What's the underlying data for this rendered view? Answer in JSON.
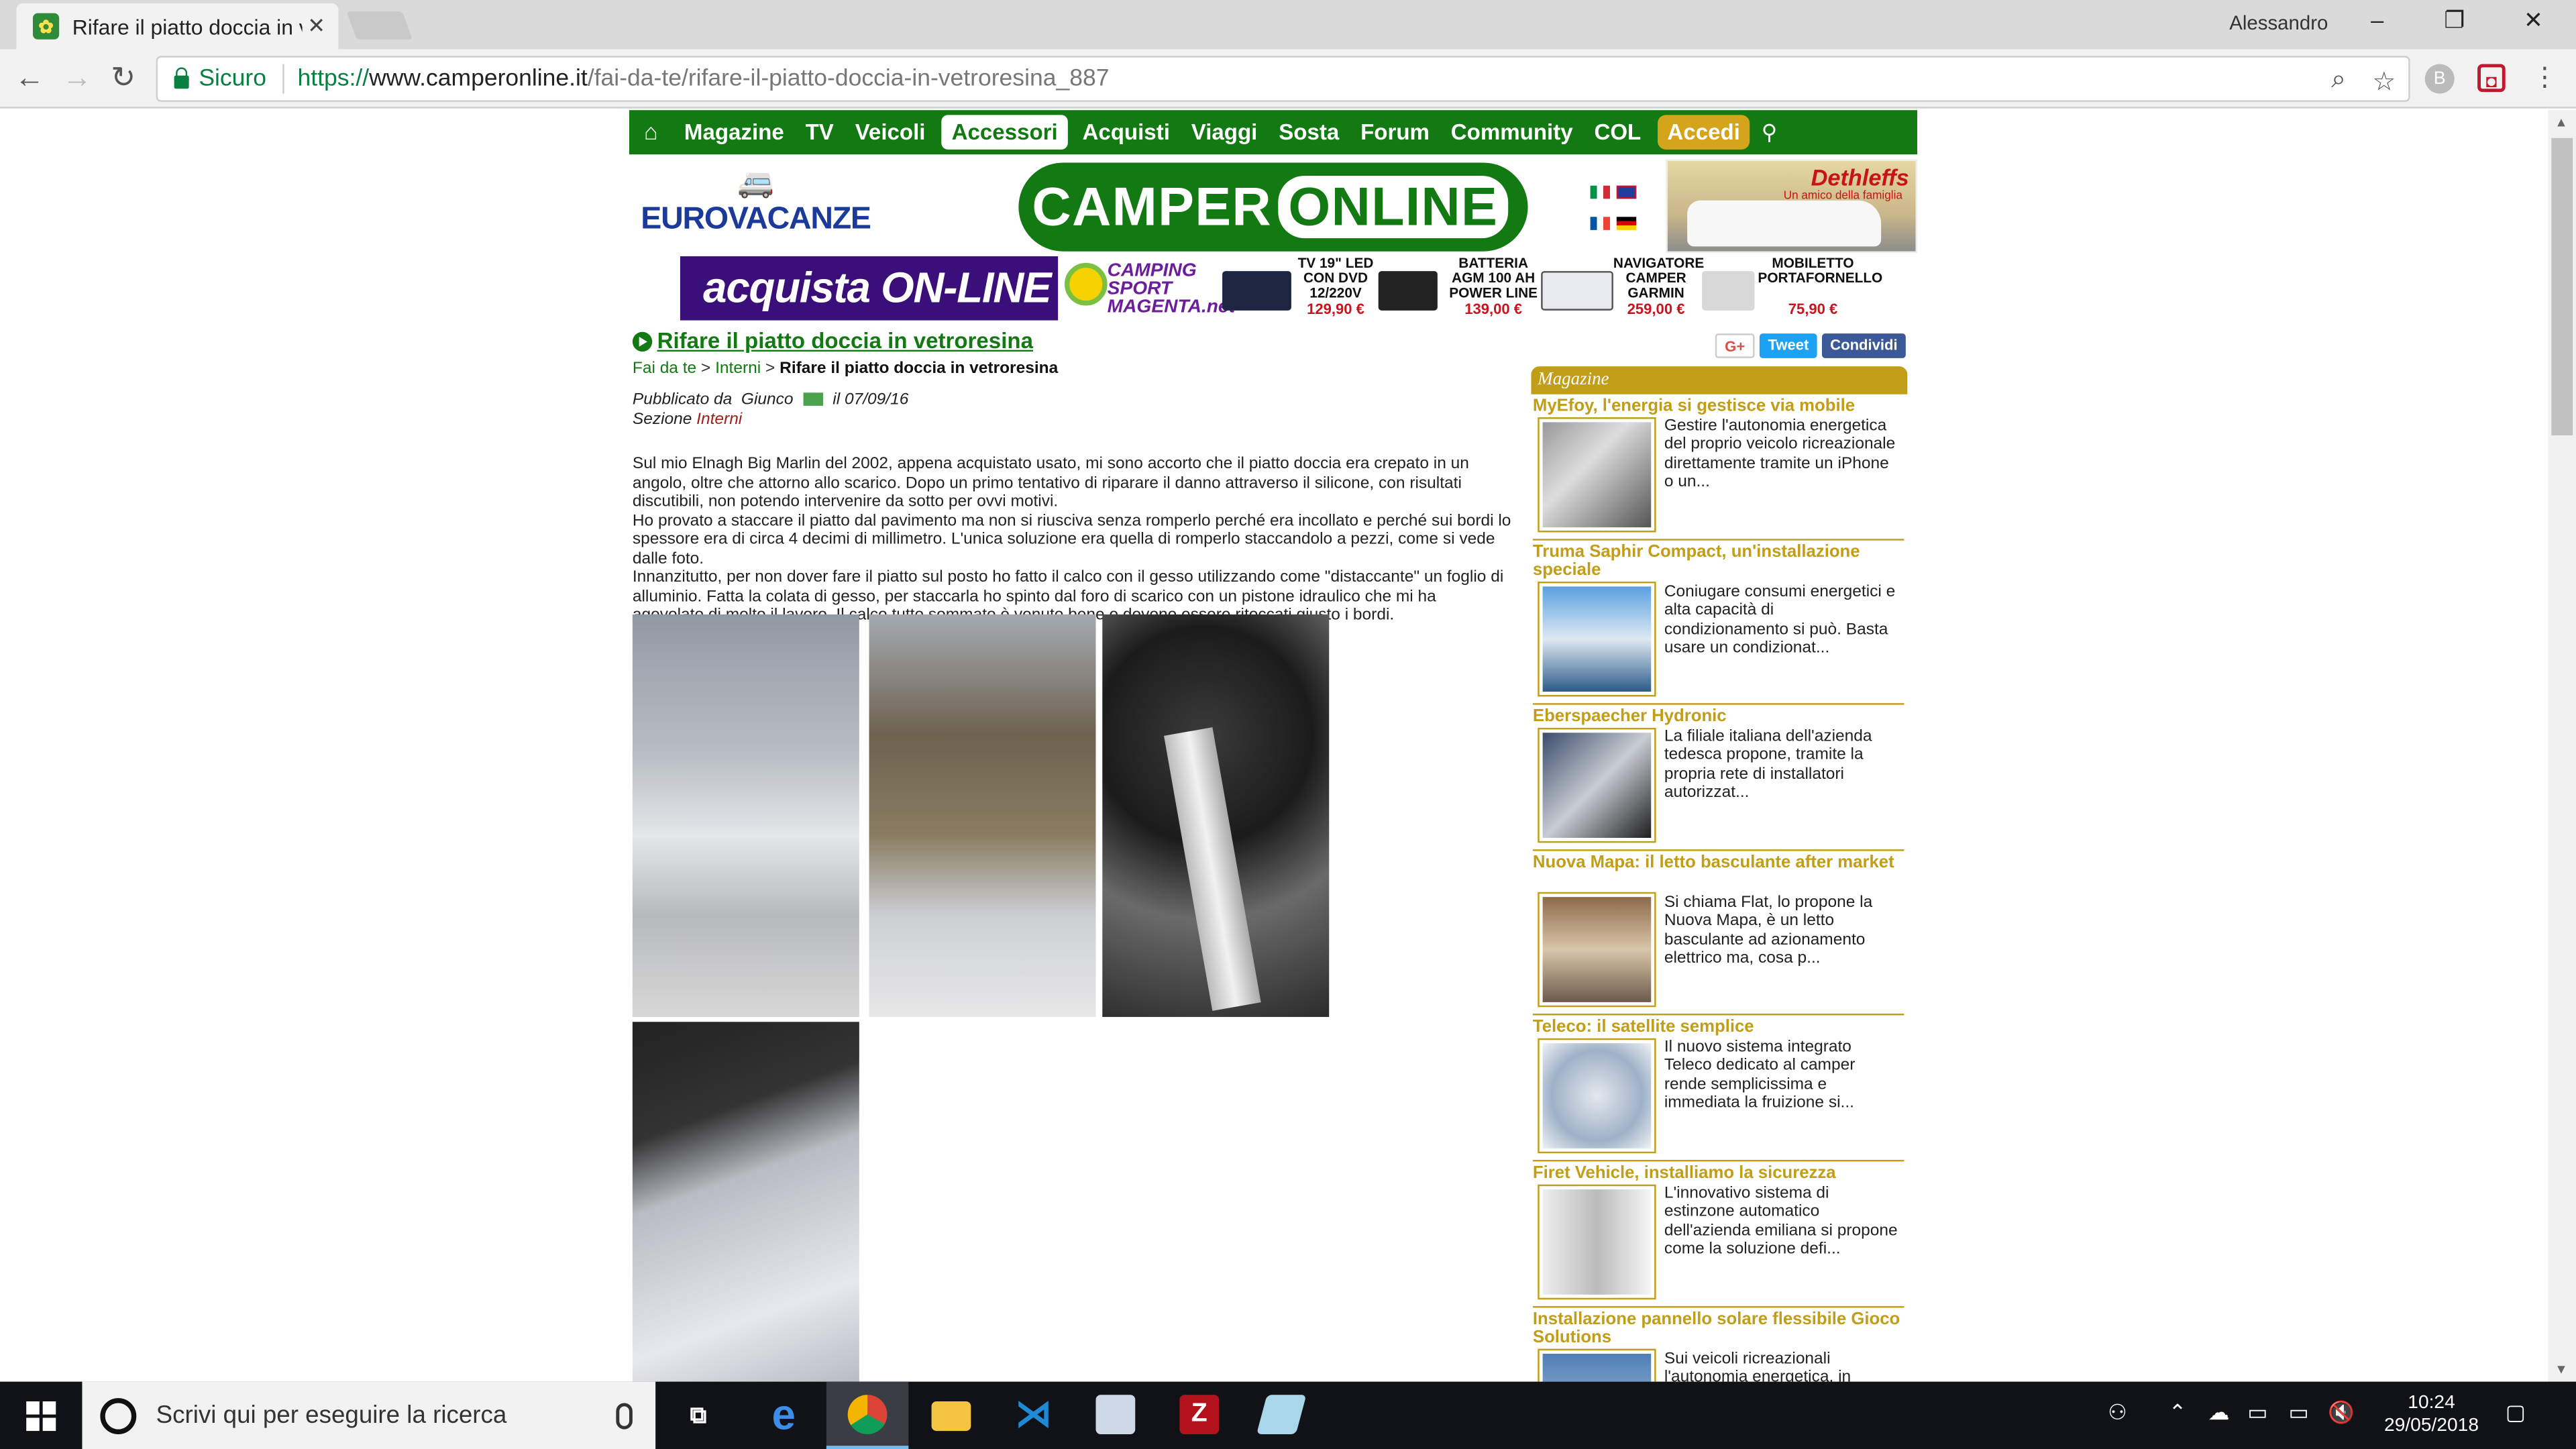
{
  "browser": {
    "tab_title": "Rifare il piatto doccia in v",
    "user_name": "Alessandro",
    "secure_label": "Sicuro",
    "url_scheme": "https://",
    "url_host": "www.camperonline.it",
    "url_path": "/fai-da-te/rifare-il-piatto-doccia-in-vetroresina_887",
    "extension_letter": "B"
  },
  "site": {
    "menu": [
      "Magazine",
      "TV",
      "Veicoli",
      "Accessori",
      "Acquisti",
      "Viaggi",
      "Sosta",
      "Forum",
      "Community",
      "COL"
    ],
    "menu_active": "Accessori",
    "login_label": "Accedi",
    "eurovacanze": "EUROVACANZE",
    "logo_left": "CAMPER",
    "logo_right": "ONLINE",
    "dethleffs": "Dethleffs",
    "dethleffs_tag": "Un amico della famiglia",
    "promo": {
      "buy": "acquista ON-LINE",
      "store": "CAMPING SPORT MAGENTA.net",
      "products": [
        {
          "title": "TV 19\" LED CON DVD 12/220V",
          "price": "129,90 €"
        },
        {
          "title": "BATTERIA AGM 100 AH POWER LINE",
          "price": "139,00 €"
        },
        {
          "title": "NAVIGATORE CAMPER GARMIN",
          "price": "259,00 €"
        },
        {
          "title": "MOBILETTO PORTAFORNELLO",
          "price": "75,90 €"
        }
      ]
    }
  },
  "article": {
    "title": "Rifare il piatto doccia in vetroresina",
    "breadcrumb": [
      "Fai da te",
      "Interni",
      "Rifare il piatto doccia in vetroresina"
    ],
    "published_label": "Pubblicato da",
    "author": "Giunco",
    "date": "il 07/09/16",
    "section_label": "Sezione",
    "section": "Interni",
    "paragraphs": [
      "Sul mio Elnagh Big Marlin del 2002, appena acquistato usato, mi sono accorto che il piatto doccia era crepato in un angolo, oltre che attorno allo scarico. Dopo un primo tentativo di riparare il danno attraverso il silicone, con risultati discutibili, non potendo intervenire da sotto per ovvi motivi.",
      "Ho provato a staccare il piatto dal pavimento ma non si riusciva senza romperlo perché era incollato e perché sui bordi lo spessore era di circa 4 decimi di millimetro. L'unica soluzione era quella di romperlo staccandolo a pezzi, come si vede dalle foto.",
      "Innanzitutto, per non dover fare il piatto sul posto ho fatto il calco con il gesso utilizzando come \"distaccante\" un foglio di alluminio. Fatta la colata di gesso, per staccarla ho spinto dal foro di scarico con un pistone idraulico che mi ha agevolato di molto il lavoro. Il calco tutto sommato è venuto bene e devono essere ritoccati giusto i bordi."
    ]
  },
  "sidebar": {
    "social": [
      "G+",
      "Tweet",
      "Condividi"
    ],
    "magazine_header": "Magazine",
    "articles": [
      {
        "title": "MyEfoy, l'energia si gestisce via mobile",
        "excerpt": "Gestire l'autonomia energetica del proprio veicolo ricreazionale direttamente tramite un iPhone o un..."
      },
      {
        "title": "Truma Saphir Compact, un'installazione speciale",
        "excerpt": "Coniugare consumi energetici e alta capacità di condizionamento si può. Basta usare un condizionat..."
      },
      {
        "title": "Eberspaecher Hydronic",
        "excerpt": "La filiale italiana dell'azienda tedesca propone, tramite la propria rete di installatori autorizzat..."
      },
      {
        "title": "Nuova Mapa: il letto basculante after market",
        "excerpt": "Si chiama Flat, lo propone la Nuova Mapa, è un letto basculante ad azionamento elettrico ma, cosa p..."
      },
      {
        "title": "Teleco: il satellite semplice",
        "excerpt": "Il nuovo sistema integrato Teleco dedicato al camper rende semplicissima e immediata la fruizione si..."
      },
      {
        "title": "Firet Vehicle, installiamo la sicurezza",
        "excerpt": "L'innovativo sistema di estinzone automatico dell'azienda emiliana si propone come la soluzione defi..."
      },
      {
        "title": "Installazione pannello solare flessibile Gioco Solutions",
        "excerpt": "Sui veicoli ricreazionali l'autonomia energetica, in"
      }
    ]
  },
  "taskbar": {
    "search_placeholder": "Scrivi qui per eseguire la ricerca",
    "time": "10:24",
    "date": "29/05/2018"
  }
}
